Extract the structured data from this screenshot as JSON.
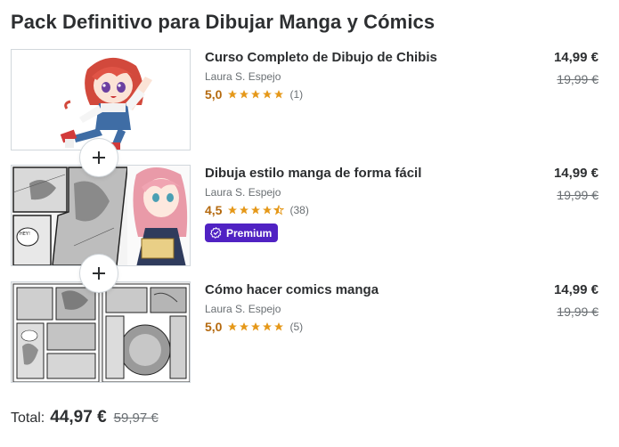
{
  "bundle": {
    "title": "Pack Definitivo para Dibujar Manga y Cómics"
  },
  "courses": [
    {
      "title": "Curso Completo de Dibujo de Chibis",
      "author": "Laura S. Espejo",
      "rating": "5,0",
      "rating_value": 5.0,
      "reviews": "(1)",
      "price": "14,99 €",
      "old_price": "19,99 €",
      "thumbnail": "chibi-girl-illustration"
    },
    {
      "title": "Dibuja estilo manga de forma fácil",
      "author": "Laura S. Espejo",
      "rating": "4,5",
      "rating_value": 4.5,
      "reviews": "(38)",
      "badge": "Premium",
      "price": "14,99 €",
      "old_price": "19,99 €",
      "thumbnail": "manga-page-illustration"
    },
    {
      "title": "Cómo hacer comics manga",
      "author": "Laura S. Espejo",
      "rating": "5,0",
      "rating_value": 5.0,
      "reviews": "(5)",
      "price": "14,99 €",
      "old_price": "19,99 €",
      "thumbnail": "manga-comic-pages"
    }
  ],
  "total": {
    "label": "Total:",
    "value": "44,97 €",
    "old_value": "59,97 €"
  },
  "colors": {
    "rating": "#b4690e",
    "star": "#e59819",
    "premium_badge": "#5022c3",
    "text": "#2d2f31",
    "muted": "#6a6f73"
  }
}
